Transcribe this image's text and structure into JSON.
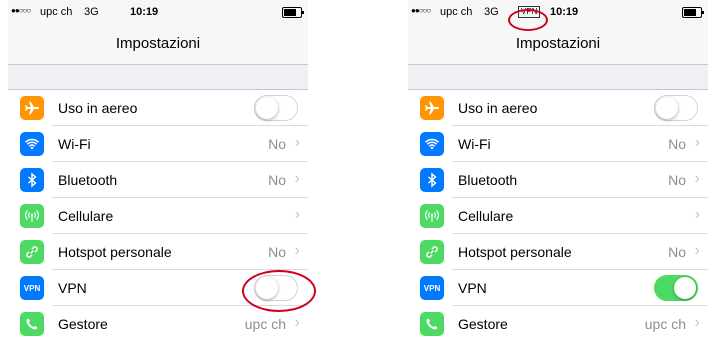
{
  "status_bar": {
    "signal": "●●○○○",
    "carrier": "upc ch",
    "network": "3G",
    "vpn_badge": "VPN",
    "time": "10:19"
  },
  "nav": {
    "title": "Impostazioni"
  },
  "rows": [
    {
      "label": "Uso in aereo",
      "icon": "airplane-icon",
      "color": "#ff9500"
    },
    {
      "label": "Wi-Fi",
      "value": "No",
      "icon": "wifi-icon",
      "color": "#007aff"
    },
    {
      "label": "Bluetooth",
      "value": "No",
      "icon": "bluetooth-icon",
      "color": "#007aff"
    },
    {
      "label": "Cellulare",
      "value": "",
      "icon": "cellular-icon",
      "color": "#4cd964"
    },
    {
      "label": "Hotspot personale",
      "value": "No",
      "icon": "hotspot-icon",
      "color": "#4cd964"
    },
    {
      "label": "VPN",
      "icon_text": "VPN",
      "icon": "vpn-icon",
      "color": "#007aff"
    },
    {
      "label": "Gestore",
      "value": "upc ch",
      "icon": "phone-icon",
      "color": "#4cd964"
    }
  ],
  "chevron": "›",
  "screens": [
    {
      "name": "before",
      "airplane_on": false,
      "vpn_on": false,
      "vpn_badge_shown": false
    },
    {
      "name": "after",
      "airplane_on": false,
      "vpn_on": true,
      "vpn_badge_shown": true
    }
  ],
  "accent_red": "#d0021b"
}
